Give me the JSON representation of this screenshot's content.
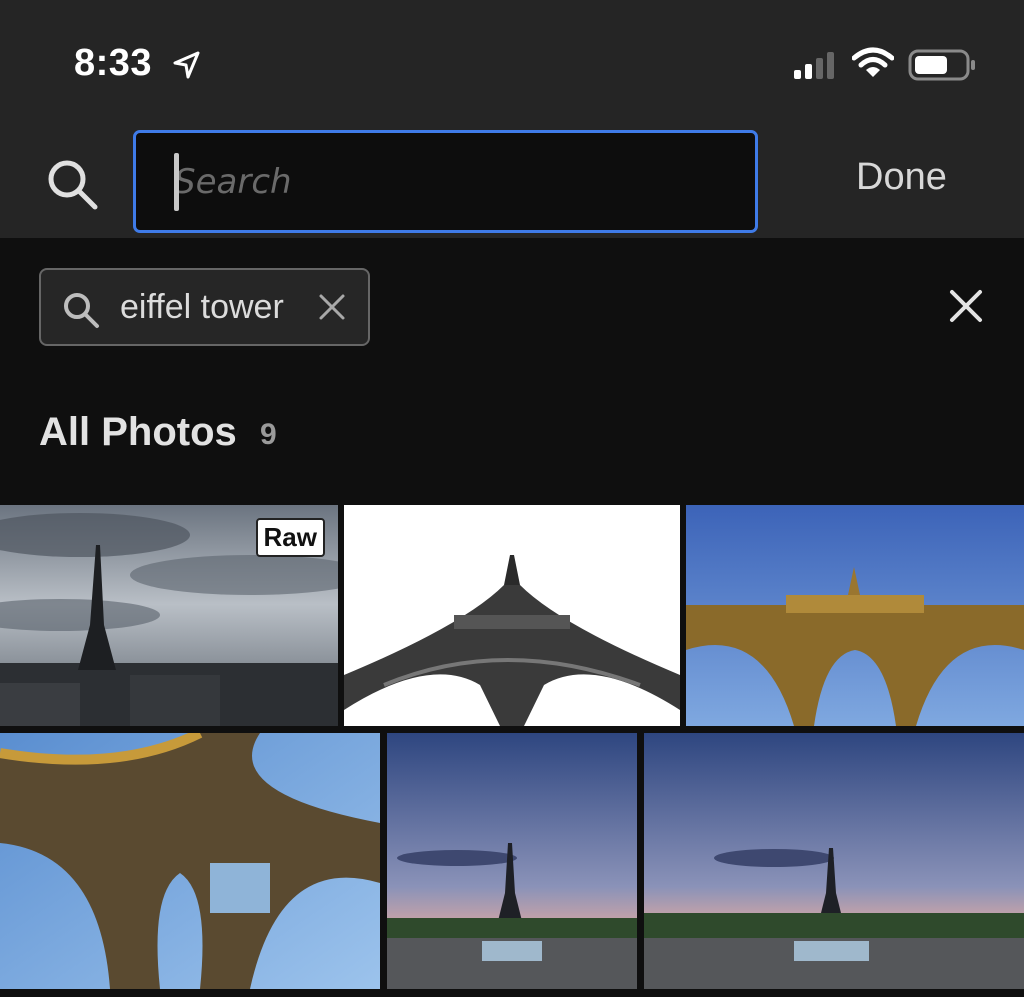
{
  "status_bar": {
    "time": "8:33"
  },
  "search": {
    "placeholder": "Search",
    "value": "",
    "done_label": "Done"
  },
  "filter_chip": {
    "label": "eiffel tower"
  },
  "section": {
    "title": "All Photos",
    "count": "9"
  },
  "photos": [
    {
      "badge": "Raw",
      "subject": "eiffel tower skyline cloudy"
    },
    {
      "subject": "eiffel tower from below black and white"
    },
    {
      "subject": "eiffel tower arches golden blue sky"
    },
    {
      "subject": "eiffel tower underside close-up"
    },
    {
      "subject": "eiffel tower dusk trocadero"
    },
    {
      "subject": "eiffel tower dusk trocadero wide"
    }
  ]
}
